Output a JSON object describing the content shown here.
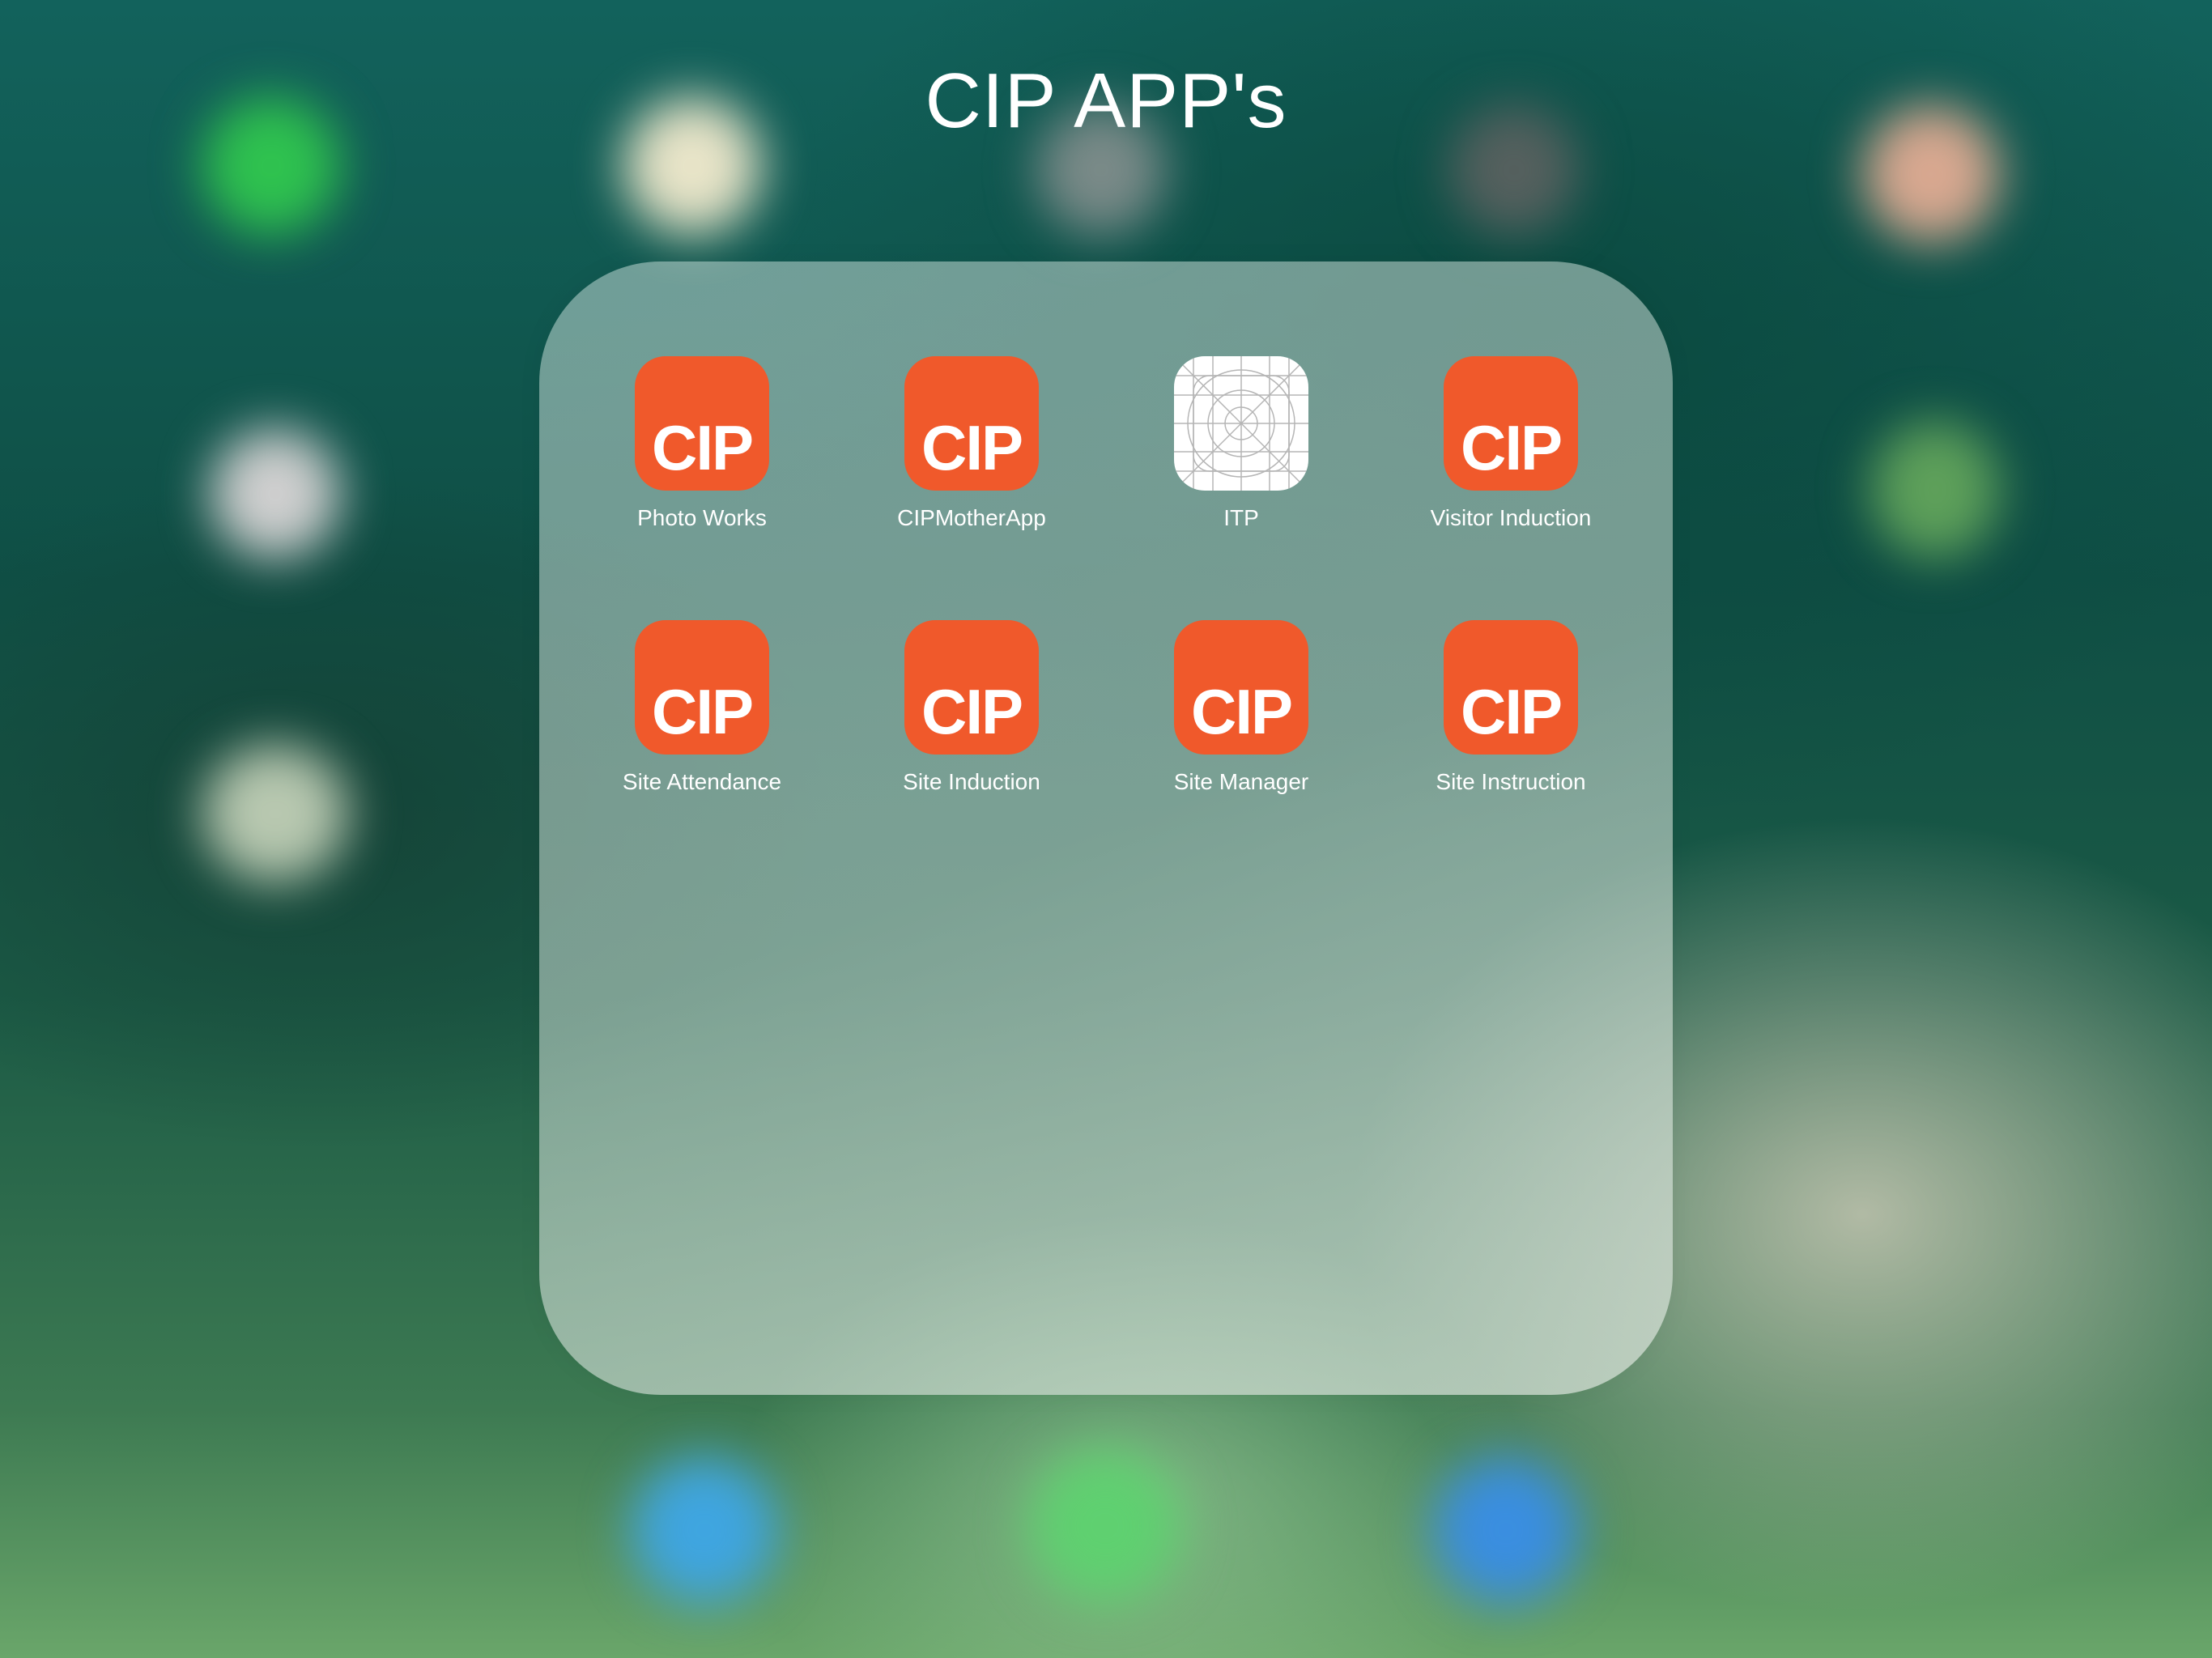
{
  "folder": {
    "title": "CIP APP's"
  },
  "apps": [
    {
      "label": "Photo Works",
      "icon": "cip-logo-icon",
      "logo_text": "CIP"
    },
    {
      "label": "CIPMotherApp",
      "icon": "cip-logo-icon",
      "logo_text": "CIP"
    },
    {
      "label": "ITP",
      "icon": "blank-app-template-icon"
    },
    {
      "label": "Visitor Induction",
      "icon": "cip-logo-icon",
      "logo_text": "CIP"
    },
    {
      "label": "Site Attendance",
      "icon": "cip-logo-icon",
      "logo_text": "CIP"
    },
    {
      "label": "Site Induction",
      "icon": "cip-logo-icon",
      "logo_text": "CIP"
    },
    {
      "label": "Site Manager",
      "icon": "cip-logo-icon",
      "logo_text": "CIP"
    },
    {
      "label": "Site Instruction",
      "icon": "cip-logo-icon",
      "logo_text": "CIP"
    }
  ],
  "colors": {
    "cip_brand": "#f0592b",
    "label_text": "#ffffff"
  }
}
